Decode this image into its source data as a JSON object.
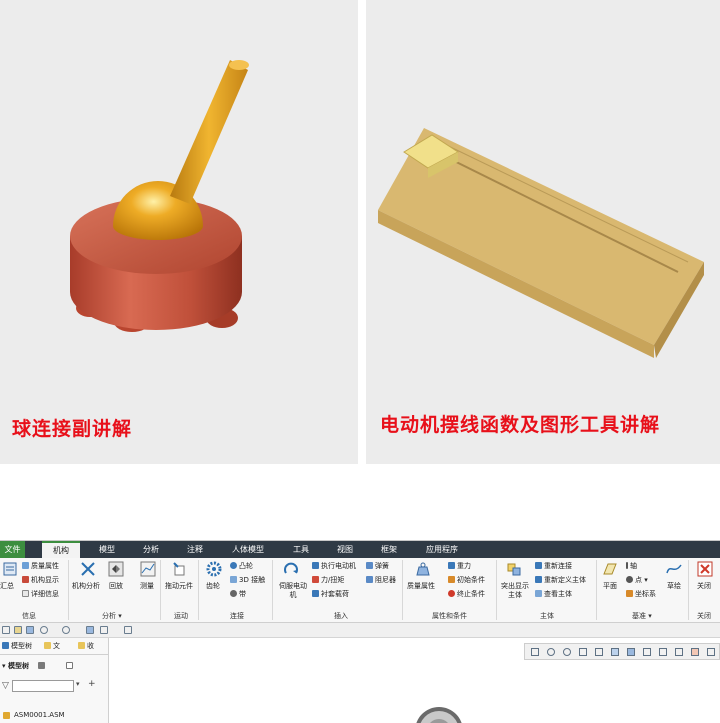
{
  "panels": {
    "left_caption": "球连接副讲解",
    "right_caption": "电动机摆线函数及图形工具讲解"
  },
  "colors": {
    "caption": "#e8101a",
    "base_red": "#c0503a",
    "ball_gold": "#e3a21a",
    "slab_tan": "#d9b870",
    "block_yellow": "#f1e08a",
    "tab_bar": "#2f3a45",
    "file_tab": "#3c8e3f"
  },
  "tabs": [
    "文件",
    "机构",
    "模型",
    "分析",
    "注释",
    "人体模型",
    "工具",
    "视图",
    "框架",
    "应用程序"
  ],
  "ribbon": {
    "info": {
      "summary": "汇总",
      "mass_props": "质量属性",
      "mech_display": "机构显示",
      "detail": "详细信息",
      "group": "信息"
    },
    "analysis": {
      "mech_analysis": "机构分析",
      "playback": "回放",
      "measure": "测量",
      "group": "分析 ▾"
    },
    "motion": {
      "drag": "拖动元件",
      "group": "运动"
    },
    "connect": {
      "gear": "齿轮",
      "cam": "凸轮",
      "contact3d": "3D 接触",
      "belt": "带",
      "group": "连接"
    },
    "insert": {
      "servo": "伺服电动机",
      "motor": "执行电动机",
      "force": "力/扭矩",
      "bushing": "衬套载荷",
      "spring": "弹簧",
      "damper": "阻尼器",
      "group": "插入"
    },
    "props": {
      "mass": "质量属性",
      "gravity": "重力",
      "init": "初始条件",
      "end": "终止条件",
      "group": "属性和条件"
    },
    "body": {
      "highlight": "突出显示主体",
      "reconnect": "重新连接",
      "redefine": "重新定义主体",
      "view": "查看主体",
      "group": "主体"
    },
    "datum": {
      "plane": "平面",
      "axis": "轴",
      "point": "点 ▾",
      "csys": "坐标系",
      "sketch": "草绘",
      "group": "基准 ▾"
    },
    "close": {
      "close": "关闭",
      "group": "关闭"
    }
  },
  "navigator": {
    "tab_model_tree": "模型树",
    "tab_files": "文",
    "tab_fav": "收",
    "tree_label": "模型树",
    "root_item": "ASM0001.ASM"
  }
}
